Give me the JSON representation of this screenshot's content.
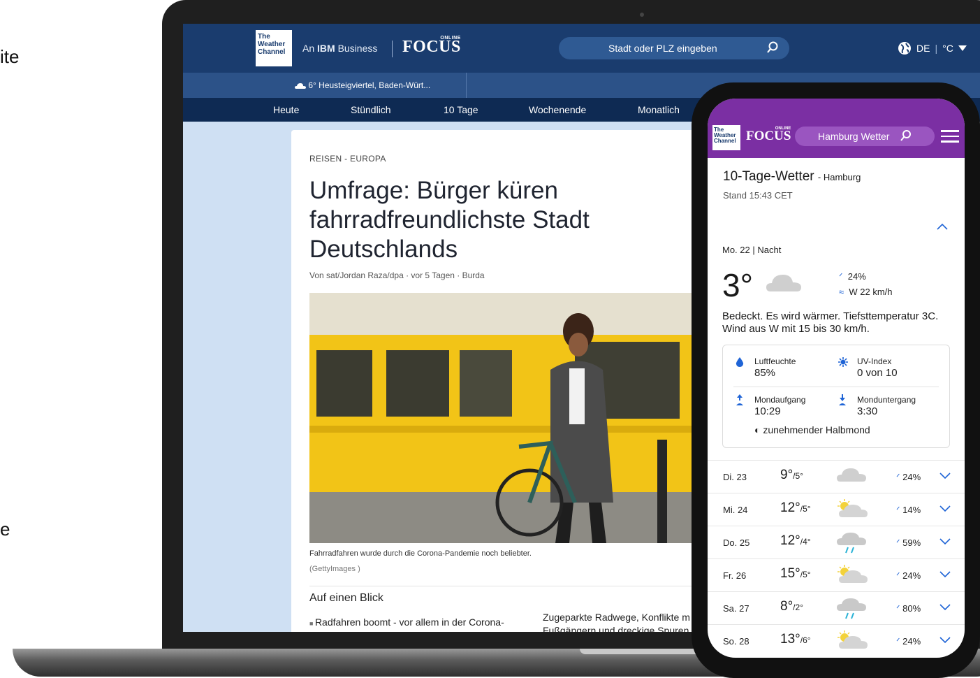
{
  "side_fragments": [
    "ite",
    "e"
  ],
  "desktop": {
    "logo_text": [
      "The",
      "Weather",
      "Channel"
    ],
    "partner": {
      "prefix": "An ",
      "brand": "IBM",
      "suffix": " Business"
    },
    "focus_logo": "FOCUS",
    "focus_online": "ONLINE",
    "search_placeholder": "Stadt oder PLZ eingeben",
    "language": "DE",
    "unit": "°C",
    "location": "6° Heusteigviertel, Baden-Würt...",
    "nav": [
      "Heute",
      "Stündlich",
      "10 Tage",
      "Wochenende",
      "Monatlich"
    ],
    "article": {
      "kicker": "REISEN - EUROPA",
      "headline": "Umfrage: Bürger küren fahrradfreundlichste Stadt Deutschlands",
      "byline": "Von sat/Jordan Raza/dpa · vor 5 Tagen · Burda",
      "caption": "Fahrradfahren wurde durch die Corona-Pandemie noch beliebter.",
      "credit": "(GettyImages )",
      "glance_title": "Auf einen Blick",
      "bullet": "Radfahren boomt - vor allem in der Corona-",
      "col2_text": "Zugeparkte Radwege, Konflikte m Fußgängern und dreckige Spuren"
    }
  },
  "mobile": {
    "logo_text": [
      "The",
      "Weather",
      "Channel"
    ],
    "focus_logo": "FOCUS",
    "focus_online": "ONLINE",
    "search_label": "Hamburg Wetter",
    "title": "10-Tage-Wetter",
    "title_city": "- Hamburg",
    "stand": "Stand 15:43 CET",
    "current": {
      "day": "Mo. 22 | Nacht",
      "temp": "3°",
      "rain": "24%",
      "wind": "W 22 km/h",
      "description": "Bedeckt. Es wird wärmer. Tiefsttemperatur 3C. Wind aus W mit 15 bis 30 km/h.",
      "humidity_label": "Luftfeuchte",
      "humidity_value": "85%",
      "uv_label": "UV-Index",
      "uv_value": "0 von 10",
      "moonrise_label": "Mondaufgang",
      "moonrise_value": "10:29",
      "moonset_label": "Monduntergang",
      "moonset_value": "3:30",
      "moon_phase": "zunehmender Halbmond"
    },
    "forecast": [
      {
        "day": "Di. 23",
        "hi": "9°",
        "lo": "/5°",
        "icon": "cloud",
        "precip": "24%"
      },
      {
        "day": "Mi. 24",
        "hi": "12°",
        "lo": "/5°",
        "icon": "sun-cloud",
        "precip": "14%"
      },
      {
        "day": "Do. 25",
        "hi": "12°",
        "lo": "/4°",
        "icon": "rain-cloud",
        "precip": "59%"
      },
      {
        "day": "Fr. 26",
        "hi": "15°",
        "lo": "/5°",
        "icon": "sun-cloud",
        "precip": "24%"
      },
      {
        "day": "Sa. 27",
        "hi": "8°",
        "lo": "/2°",
        "icon": "rain-cloud",
        "precip": "80%"
      },
      {
        "day": "So. 28",
        "hi": "13°",
        "lo": "/6°",
        "icon": "sun-cloud",
        "precip": "24%"
      }
    ]
  },
  "colors": {
    "desktop_header": "#1a3c6e",
    "desktop_nav": "#0e2a53",
    "mobile_header": "#7b2fa3",
    "accent_blue": "#1f64d6"
  }
}
